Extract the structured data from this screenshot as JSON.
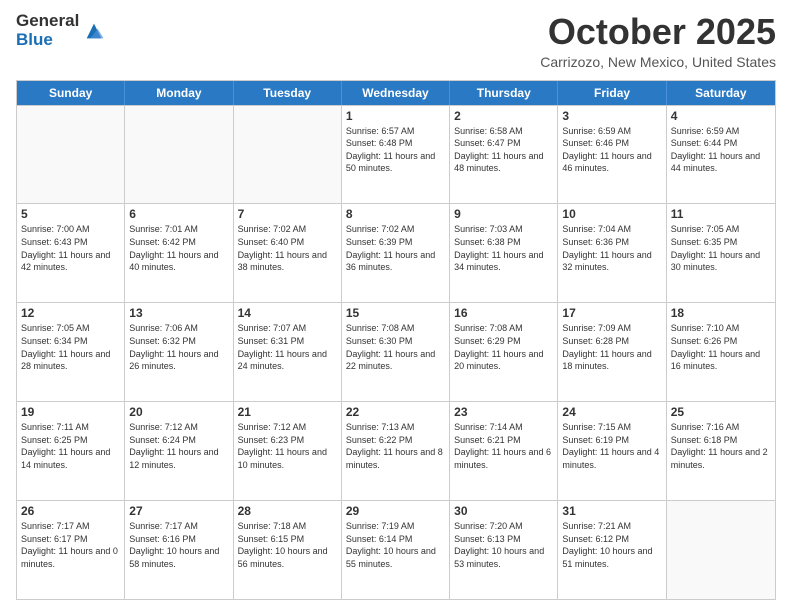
{
  "logo": {
    "general": "General",
    "blue": "Blue"
  },
  "header": {
    "month": "October 2025",
    "location": "Carrizozo, New Mexico, United States"
  },
  "weekdays": [
    "Sunday",
    "Monday",
    "Tuesday",
    "Wednesday",
    "Thursday",
    "Friday",
    "Saturday"
  ],
  "weeks": [
    [
      {
        "day": "",
        "sunrise": "",
        "sunset": "",
        "daylight": ""
      },
      {
        "day": "",
        "sunrise": "",
        "sunset": "",
        "daylight": ""
      },
      {
        "day": "",
        "sunrise": "",
        "sunset": "",
        "daylight": ""
      },
      {
        "day": "1",
        "sunrise": "Sunrise: 6:57 AM",
        "sunset": "Sunset: 6:48 PM",
        "daylight": "Daylight: 11 hours and 50 minutes."
      },
      {
        "day": "2",
        "sunrise": "Sunrise: 6:58 AM",
        "sunset": "Sunset: 6:47 PM",
        "daylight": "Daylight: 11 hours and 48 minutes."
      },
      {
        "day": "3",
        "sunrise": "Sunrise: 6:59 AM",
        "sunset": "Sunset: 6:46 PM",
        "daylight": "Daylight: 11 hours and 46 minutes."
      },
      {
        "day": "4",
        "sunrise": "Sunrise: 6:59 AM",
        "sunset": "Sunset: 6:44 PM",
        "daylight": "Daylight: 11 hours and 44 minutes."
      }
    ],
    [
      {
        "day": "5",
        "sunrise": "Sunrise: 7:00 AM",
        "sunset": "Sunset: 6:43 PM",
        "daylight": "Daylight: 11 hours and 42 minutes."
      },
      {
        "day": "6",
        "sunrise": "Sunrise: 7:01 AM",
        "sunset": "Sunset: 6:42 PM",
        "daylight": "Daylight: 11 hours and 40 minutes."
      },
      {
        "day": "7",
        "sunrise": "Sunrise: 7:02 AM",
        "sunset": "Sunset: 6:40 PM",
        "daylight": "Daylight: 11 hours and 38 minutes."
      },
      {
        "day": "8",
        "sunrise": "Sunrise: 7:02 AM",
        "sunset": "Sunset: 6:39 PM",
        "daylight": "Daylight: 11 hours and 36 minutes."
      },
      {
        "day": "9",
        "sunrise": "Sunrise: 7:03 AM",
        "sunset": "Sunset: 6:38 PM",
        "daylight": "Daylight: 11 hours and 34 minutes."
      },
      {
        "day": "10",
        "sunrise": "Sunrise: 7:04 AM",
        "sunset": "Sunset: 6:36 PM",
        "daylight": "Daylight: 11 hours and 32 minutes."
      },
      {
        "day": "11",
        "sunrise": "Sunrise: 7:05 AM",
        "sunset": "Sunset: 6:35 PM",
        "daylight": "Daylight: 11 hours and 30 minutes."
      }
    ],
    [
      {
        "day": "12",
        "sunrise": "Sunrise: 7:05 AM",
        "sunset": "Sunset: 6:34 PM",
        "daylight": "Daylight: 11 hours and 28 minutes."
      },
      {
        "day": "13",
        "sunrise": "Sunrise: 7:06 AM",
        "sunset": "Sunset: 6:32 PM",
        "daylight": "Daylight: 11 hours and 26 minutes."
      },
      {
        "day": "14",
        "sunrise": "Sunrise: 7:07 AM",
        "sunset": "Sunset: 6:31 PM",
        "daylight": "Daylight: 11 hours and 24 minutes."
      },
      {
        "day": "15",
        "sunrise": "Sunrise: 7:08 AM",
        "sunset": "Sunset: 6:30 PM",
        "daylight": "Daylight: 11 hours and 22 minutes."
      },
      {
        "day": "16",
        "sunrise": "Sunrise: 7:08 AM",
        "sunset": "Sunset: 6:29 PM",
        "daylight": "Daylight: 11 hours and 20 minutes."
      },
      {
        "day": "17",
        "sunrise": "Sunrise: 7:09 AM",
        "sunset": "Sunset: 6:28 PM",
        "daylight": "Daylight: 11 hours and 18 minutes."
      },
      {
        "day": "18",
        "sunrise": "Sunrise: 7:10 AM",
        "sunset": "Sunset: 6:26 PM",
        "daylight": "Daylight: 11 hours and 16 minutes."
      }
    ],
    [
      {
        "day": "19",
        "sunrise": "Sunrise: 7:11 AM",
        "sunset": "Sunset: 6:25 PM",
        "daylight": "Daylight: 11 hours and 14 minutes."
      },
      {
        "day": "20",
        "sunrise": "Sunrise: 7:12 AM",
        "sunset": "Sunset: 6:24 PM",
        "daylight": "Daylight: 11 hours and 12 minutes."
      },
      {
        "day": "21",
        "sunrise": "Sunrise: 7:12 AM",
        "sunset": "Sunset: 6:23 PM",
        "daylight": "Daylight: 11 hours and 10 minutes."
      },
      {
        "day": "22",
        "sunrise": "Sunrise: 7:13 AM",
        "sunset": "Sunset: 6:22 PM",
        "daylight": "Daylight: 11 hours and 8 minutes."
      },
      {
        "day": "23",
        "sunrise": "Sunrise: 7:14 AM",
        "sunset": "Sunset: 6:21 PM",
        "daylight": "Daylight: 11 hours and 6 minutes."
      },
      {
        "day": "24",
        "sunrise": "Sunrise: 7:15 AM",
        "sunset": "Sunset: 6:19 PM",
        "daylight": "Daylight: 11 hours and 4 minutes."
      },
      {
        "day": "25",
        "sunrise": "Sunrise: 7:16 AM",
        "sunset": "Sunset: 6:18 PM",
        "daylight": "Daylight: 11 hours and 2 minutes."
      }
    ],
    [
      {
        "day": "26",
        "sunrise": "Sunrise: 7:17 AM",
        "sunset": "Sunset: 6:17 PM",
        "daylight": "Daylight: 11 hours and 0 minutes."
      },
      {
        "day": "27",
        "sunrise": "Sunrise: 7:17 AM",
        "sunset": "Sunset: 6:16 PM",
        "daylight": "Daylight: 10 hours and 58 minutes."
      },
      {
        "day": "28",
        "sunrise": "Sunrise: 7:18 AM",
        "sunset": "Sunset: 6:15 PM",
        "daylight": "Daylight: 10 hours and 56 minutes."
      },
      {
        "day": "29",
        "sunrise": "Sunrise: 7:19 AM",
        "sunset": "Sunset: 6:14 PM",
        "daylight": "Daylight: 10 hours and 55 minutes."
      },
      {
        "day": "30",
        "sunrise": "Sunrise: 7:20 AM",
        "sunset": "Sunset: 6:13 PM",
        "daylight": "Daylight: 10 hours and 53 minutes."
      },
      {
        "day": "31",
        "sunrise": "Sunrise: 7:21 AM",
        "sunset": "Sunset: 6:12 PM",
        "daylight": "Daylight: 10 hours and 51 minutes."
      },
      {
        "day": "",
        "sunrise": "",
        "sunset": "",
        "daylight": ""
      }
    ]
  ]
}
